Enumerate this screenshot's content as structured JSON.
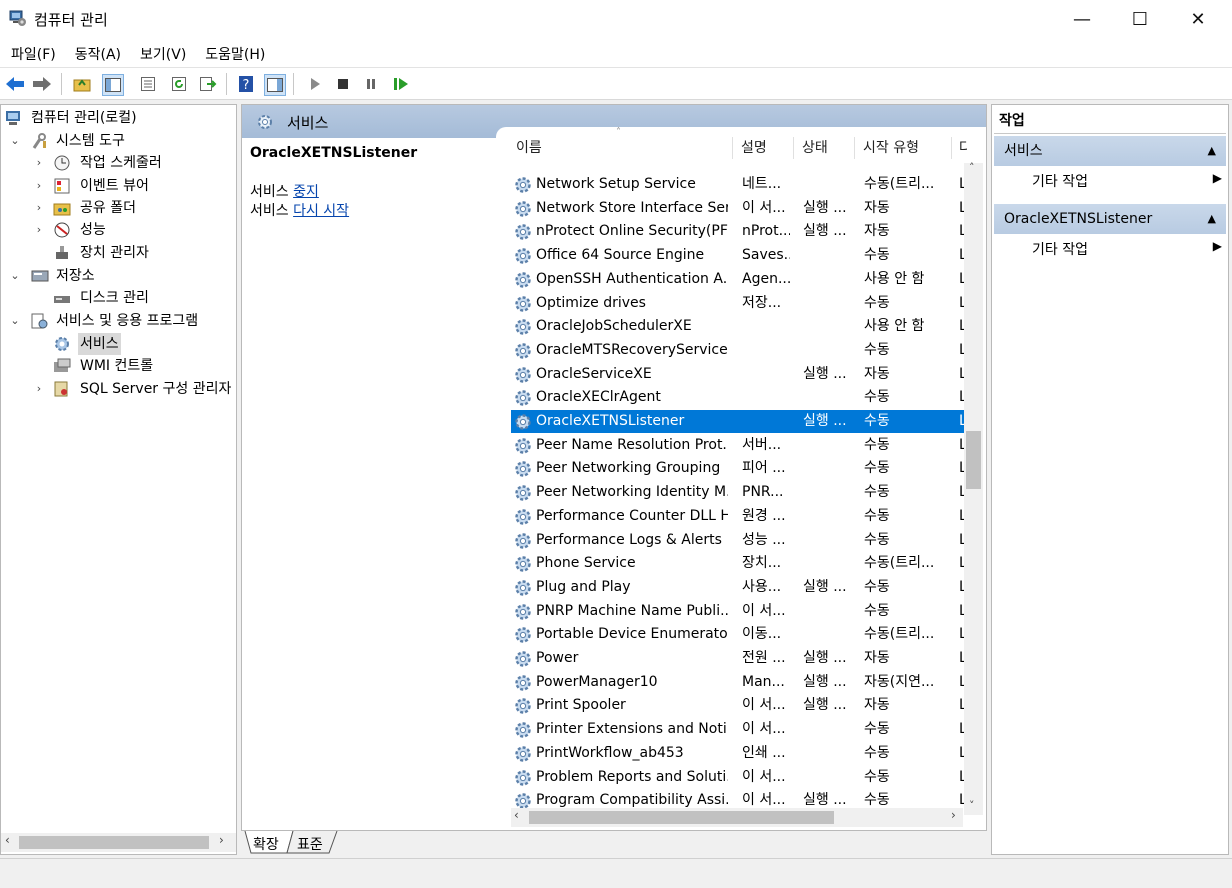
{
  "window": {
    "title": "컴퓨터 관리",
    "minimize": "—",
    "maximize": "☐",
    "close": "✕"
  },
  "menu": [
    "파일(F)",
    "동작(A)",
    "보기(V)",
    "도움말(H)"
  ],
  "tree": {
    "root": "컴퓨터 관리(로컬)",
    "items": [
      {
        "label": "시스템 도구",
        "icon": "tools-icon"
      },
      {
        "label": "작업 스케줄러",
        "icon": "clock-icon"
      },
      {
        "label": "이벤트 뷰어",
        "icon": "event-viewer-icon"
      },
      {
        "label": "공유 폴더",
        "icon": "shared-folder-icon"
      },
      {
        "label": "성능",
        "icon": "performance-icon"
      },
      {
        "label": "장치 관리자",
        "icon": "device-manager-icon"
      },
      {
        "label": "저장소",
        "icon": "storage-icon"
      },
      {
        "label": "디스크 관리",
        "icon": "disk-icon"
      },
      {
        "label": "서비스 및 응용 프로그램",
        "icon": "services-apps-icon"
      },
      {
        "label": "서비스",
        "icon": "gear-icon"
      },
      {
        "label": "WMI 컨트롤",
        "icon": "wmi-icon"
      },
      {
        "label": "SQL Server 구성 관리자",
        "icon": "sql-icon"
      }
    ]
  },
  "center": {
    "header": "서비스",
    "selected_service": "OracleXETNSListener",
    "detail_prefix1": "서비스 ",
    "detail_link1": "중지",
    "detail_prefix2": "서비스 ",
    "detail_link2": "다시 시작",
    "columns": [
      "이름",
      "설명",
      "상태",
      "시작 유형",
      "다"
    ],
    "rows": [
      [
        "Network Setup Service",
        "네트...",
        "",
        "수동(트리...",
        "L"
      ],
      [
        "Network Store Interface Ser...",
        "이 서...",
        "실행 ...",
        "자동",
        "L"
      ],
      [
        "nProtect Online Security(PFS)",
        "nProt...",
        "실행 ...",
        "자동",
        "L"
      ],
      [
        "Office 64 Source Engine",
        "Saves...",
        "",
        "수동",
        "L"
      ],
      [
        "OpenSSH Authentication A...",
        "Agen...",
        "",
        "사용 안 함",
        "L"
      ],
      [
        "Optimize drives",
        "저장...",
        "",
        "수동",
        "L"
      ],
      [
        "OracleJobSchedulerXE",
        "",
        "",
        "사용 안 함",
        "L"
      ],
      [
        "OracleMTSRecoveryService",
        "",
        "",
        "수동",
        "L"
      ],
      [
        "OracleServiceXE",
        "",
        "실행 ...",
        "자동",
        "L"
      ],
      [
        "OracleXEClrAgent",
        "",
        "",
        "수동",
        "L"
      ],
      [
        "OracleXETNSListener",
        "",
        "실행 ...",
        "수동",
        "L"
      ],
      [
        "Peer Name Resolution Prot...",
        "서버...",
        "",
        "수동",
        "L"
      ],
      [
        "Peer Networking Grouping",
        "피어 ...",
        "",
        "수동",
        "L"
      ],
      [
        "Peer Networking Identity M...",
        "PNR...",
        "",
        "수동",
        "L"
      ],
      [
        "Performance Counter DLL H...",
        "원경 ...",
        "",
        "수동",
        "L"
      ],
      [
        "Performance Logs & Alerts",
        "성능 ...",
        "",
        "수동",
        "L"
      ],
      [
        "Phone Service",
        "장치...",
        "",
        "수동(트리...",
        "L"
      ],
      [
        "Plug and Play",
        "사용...",
        "실행 ...",
        "수동",
        "L"
      ],
      [
        "PNRP Machine Name Publi...",
        "이 서...",
        "",
        "수동",
        "L"
      ],
      [
        "Portable Device Enumerator...",
        "이동...",
        "",
        "수동(트리...",
        "L"
      ],
      [
        "Power",
        "전원 ...",
        "실행 ...",
        "자동",
        "L"
      ],
      [
        "PowerManager10",
        "Man...",
        "실행 ...",
        "자동(지연...",
        "L"
      ],
      [
        "Print Spooler",
        "이 서...",
        "실행 ...",
        "자동",
        "L"
      ],
      [
        "Printer Extensions and Noti...",
        "이 서...",
        "",
        "수동",
        "L"
      ],
      [
        "PrintWorkflow_ab453",
        "인쇄 ...",
        "",
        "수동",
        "L"
      ],
      [
        "Problem Reports and Soluti...",
        "이 서...",
        "",
        "수동",
        "L"
      ],
      [
        "Program Compatibility Assi...",
        "이 서...",
        "실행 ...",
        "수동",
        "L"
      ]
    ],
    "selected_row": 10,
    "tabs": [
      "확장",
      "표준"
    ]
  },
  "actions": {
    "title": "작업",
    "groups": [
      {
        "header": "서비스",
        "item": "기타 작업"
      },
      {
        "header": "OracleXETNSListener",
        "item": "기타 작업"
      }
    ]
  },
  "colors": {
    "selection": "#0078d7",
    "header_blue": "#a9bfda"
  }
}
